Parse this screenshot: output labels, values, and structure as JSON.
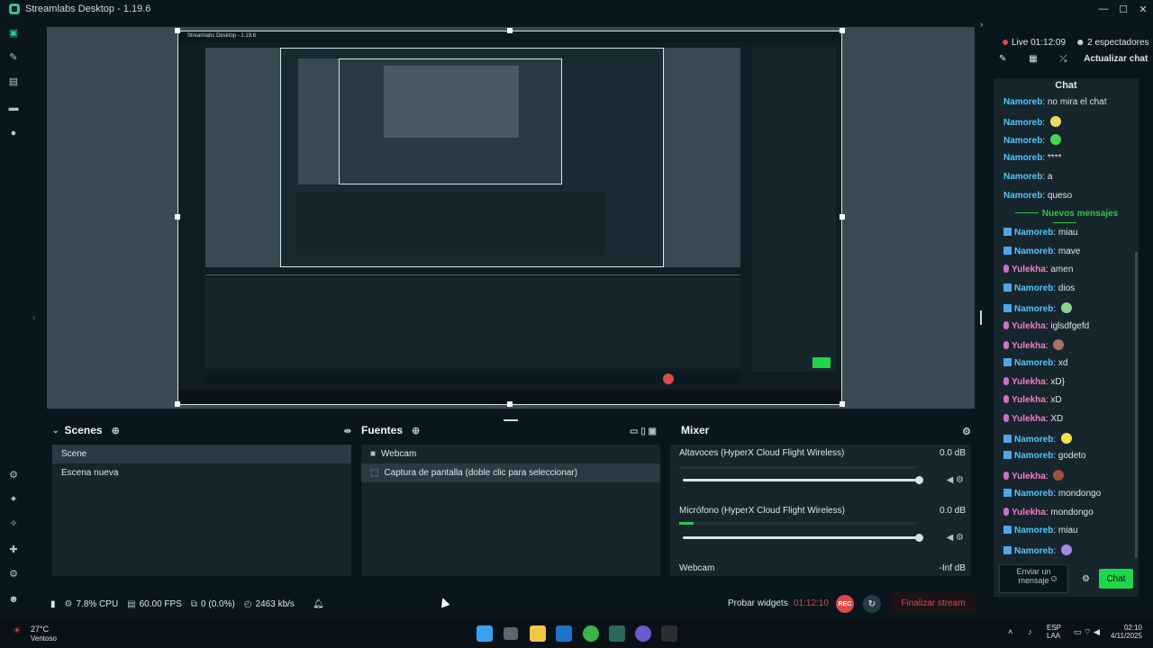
{
  "window": {
    "title": "Streamlabs Desktop - 1.19.6",
    "minimize": "—",
    "maximize": "☐",
    "close": "✕"
  },
  "icons": {
    "app": "streamlabs-logo-icon"
  },
  "preview": {
    "nested_title": "Streamlabs Desktop - 1.19.6"
  },
  "scenes": {
    "title": "Scenes",
    "items": [
      "Scene",
      "Escena nueva"
    ],
    "selected": 0
  },
  "sources": {
    "title": "Fuentes",
    "items": [
      {
        "label": "Webcam",
        "icon": "camera-icon"
      },
      {
        "label": "Captura de pantalla (doble clic para seleccionar)",
        "icon": "screen-capture-icon"
      }
    ]
  },
  "mixer": {
    "title": "Mixer",
    "channels": [
      {
        "label": "Altavoces (HyperX Cloud Flight Wireless)",
        "db": "0.0 dB",
        "level": 1.0
      },
      {
        "label": "Micrófono (HyperX Cloud Flight Wireless)",
        "db": "0.0 dB",
        "level": 1.0
      },
      {
        "label": "Webcam",
        "db": "-Inf dB"
      }
    ]
  },
  "status": {
    "cpu": "7.8% CPU",
    "fps": "60.00 FPS",
    "dropped": "0 (0.0%)",
    "bitrate": "2463 kb/s",
    "widgets": "Probar widgets",
    "time": "01:12:10",
    "rec": "REC",
    "end_stream": "Finalizar stream"
  },
  "chat_panel": {
    "live": "Live 01:12:09",
    "viewers": "2 espectadores",
    "refresh": "Actualizar chat",
    "title": "Chat",
    "new_messages": "Nuevos mensajes",
    "input_placeholder": "Enviar un mensaje",
    "send": "Chat",
    "messages_before": [
      {
        "user": "Namoreb",
        "role": "n",
        "text": "no mira el chat"
      },
      {
        "user": "Namoreb",
        "role": "n",
        "text": "",
        "emote": "#e8e05a"
      },
      {
        "user": "Namoreb",
        "role": "n",
        "text": "",
        "emote": "#4bd64a"
      },
      {
        "user": "Namoreb",
        "role": "n",
        "text": "****"
      },
      {
        "user": "Namoreb",
        "role": "n",
        "text": "a"
      },
      {
        "user": "Namoreb",
        "role": "n",
        "text": "queso"
      }
    ],
    "messages_after": [
      {
        "user": "Namoreb",
        "role": "n",
        "text": "miau"
      },
      {
        "user": "Namoreb",
        "role": "n",
        "text": "mave"
      },
      {
        "user": "Yulekha",
        "role": "y",
        "text": "amen"
      },
      {
        "user": "Namoreb",
        "role": "n",
        "text": "dios"
      },
      {
        "user": "Namoreb",
        "role": "n",
        "text": "",
        "emote": "#8fd08f"
      },
      {
        "user": "Yulekha",
        "role": "y",
        "text": "iglsdfgefd"
      },
      {
        "user": "Yulekha",
        "role": "y",
        "text": "",
        "emote": "#b07060"
      },
      {
        "user": "Namoreb",
        "role": "n",
        "text": "xd"
      },
      {
        "user": "Yulekha",
        "role": "y",
        "text": "xD}"
      },
      {
        "user": "Yulekha",
        "role": "y",
        "text": "xD"
      },
      {
        "user": "Yulekha",
        "role": "y",
        "text": "XD"
      },
      {
        "user": "Namoreb",
        "role": "n",
        "text": "",
        "emote": "#f2e44a"
      },
      {
        "user": "Namoreb",
        "role": "n",
        "text": "godeto"
      },
      {
        "user": "Yulekha",
        "role": "y",
        "text": "",
        "emote": "#a0503a"
      },
      {
        "user": "Namoreb",
        "role": "n",
        "text": "mondongo"
      },
      {
        "user": "Yulekha",
        "role": "y",
        "text": "mondongo"
      },
      {
        "user": "Namoreb",
        "role": "n",
        "text": "miau"
      },
      {
        "user": "Namoreb",
        "role": "n",
        "text": "",
        "emote": "#a48ae8"
      }
    ]
  },
  "taskbar": {
    "weather_temp": "27°C",
    "weather_desc": "Ventoso",
    "lang1": "ESP",
    "lang2": "LAA",
    "clock": "02:10",
    "date": "4/11/2025"
  },
  "colors": {
    "accent": "#31c3a2",
    "live": "#e04848",
    "send": "#1fd64a",
    "end": "#e04848"
  }
}
